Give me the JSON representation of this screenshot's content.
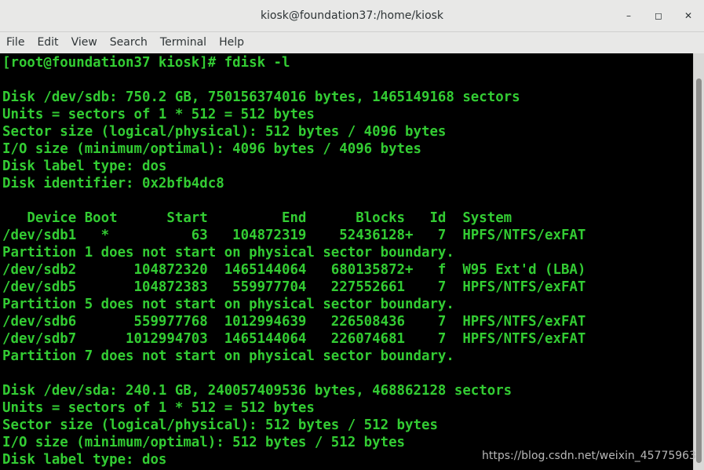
{
  "window": {
    "title": "kiosk@foundation37:/home/kiosk",
    "minimize_glyph": "–",
    "maximize_glyph": "◻",
    "close_glyph": "✕"
  },
  "menu": [
    "File",
    "Edit",
    "View",
    "Search",
    "Terminal",
    "Help"
  ],
  "terminal": {
    "color": "#33cc33",
    "lines": [
      "[root@foundation37 kiosk]# fdisk -l",
      "",
      "Disk /dev/sdb: 750.2 GB, 750156374016 bytes, 1465149168 sectors",
      "Units = sectors of 1 * 512 = 512 bytes",
      "Sector size (logical/physical): 512 bytes / 4096 bytes",
      "I/O size (minimum/optimal): 4096 bytes / 4096 bytes",
      "Disk label type: dos",
      "Disk identifier: 0x2bfb4dc8",
      "",
      "   Device Boot      Start         End      Blocks   Id  System",
      "/dev/sdb1   *          63   104872319    52436128+   7  HPFS/NTFS/exFAT",
      "Partition 1 does not start on physical sector boundary.",
      "/dev/sdb2       104872320  1465144064   680135872+   f  W95 Ext'd (LBA)",
      "/dev/sdb5       104872383   559977704   227552661    7  HPFS/NTFS/exFAT",
      "Partition 5 does not start on physical sector boundary.",
      "/dev/sdb6       559977768  1012994639   226508436    7  HPFS/NTFS/exFAT",
      "/dev/sdb7      1012994703  1465144064   226074681    7  HPFS/NTFS/exFAT",
      "Partition 7 does not start on physical sector boundary.",
      "",
      "Disk /dev/sda: 240.1 GB, 240057409536 bytes, 468862128 sectors",
      "Units = sectors of 1 * 512 = 512 bytes",
      "Sector size (logical/physical): 512 bytes / 512 bytes",
      "I/O size (minimum/optimal): 512 bytes / 512 bytes",
      "Disk label type: dos"
    ]
  },
  "watermark": "https://blog.csdn.net/weixin_45775963"
}
